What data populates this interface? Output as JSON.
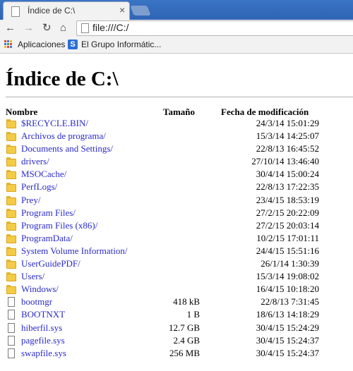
{
  "browser": {
    "tab_title": "Índice de C:\\",
    "tab_close": "×",
    "address": "file:///C:/",
    "bookmarks": [
      {
        "label": "Aplicaciones",
        "icon": "apps-grid-icon"
      },
      {
        "label": "El Grupo Informátic...",
        "icon": "site-favicon-icon"
      }
    ]
  },
  "page": {
    "heading": "Índice de C:\\",
    "columns": {
      "name": "Nombre",
      "size": "Tamaño",
      "date": "Fecha de modificación"
    }
  },
  "entries": [
    {
      "type": "folder",
      "name": "$RECYCLE.BIN/",
      "size": "",
      "date": "24/3/14 15:01:29"
    },
    {
      "type": "folder",
      "name": "Archivos de programa/",
      "size": "",
      "date": "15/3/14 14:25:07"
    },
    {
      "type": "folder",
      "name": "Documents and Settings/",
      "size": "",
      "date": "22/8/13 16:45:52"
    },
    {
      "type": "folder",
      "name": "drivers/",
      "size": "",
      "date": "27/10/14 13:46:40"
    },
    {
      "type": "folder",
      "name": "MSOCache/",
      "size": "",
      "date": "30/4/14 15:00:24"
    },
    {
      "type": "folder",
      "name": "PerfLogs/",
      "size": "",
      "date": "22/8/13 17:22:35"
    },
    {
      "type": "folder",
      "name": "Prey/",
      "size": "",
      "date": "23/4/15 18:53:19"
    },
    {
      "type": "folder",
      "name": "Program Files/",
      "size": "",
      "date": "27/2/15 20:22:09"
    },
    {
      "type": "folder",
      "name": "Program Files (x86)/",
      "size": "",
      "date": "27/2/15 20:03:14"
    },
    {
      "type": "folder",
      "name": "ProgramData/",
      "size": "",
      "date": "10/2/15 17:01:11"
    },
    {
      "type": "folder",
      "name": "System Volume Information/",
      "size": "",
      "date": "24/4/15 15:51:16"
    },
    {
      "type": "folder",
      "name": "UserGuidePDF/",
      "size": "",
      "date": "26/1/14 1:30:39"
    },
    {
      "type": "folder",
      "name": "Users/",
      "size": "",
      "date": "15/3/14 19:08:02"
    },
    {
      "type": "folder",
      "name": "Windows/",
      "size": "",
      "date": "16/4/15 10:18:20"
    },
    {
      "type": "file",
      "name": "bootmgr",
      "size": "418 kB",
      "date": "22/8/13 7:31:45"
    },
    {
      "type": "file",
      "name": "BOOTNXT",
      "size": "1 B",
      "date": "18/6/13 14:18:29"
    },
    {
      "type": "file",
      "name": "hiberfil.sys",
      "size": "12.7 GB",
      "date": "30/4/15 15:24:29"
    },
    {
      "type": "file",
      "name": "pagefile.sys",
      "size": "2.4 GB",
      "date": "30/4/15 15:24:37"
    },
    {
      "type": "file",
      "name": "swapfile.sys",
      "size": "256 MB",
      "date": "30/4/15 15:24:37"
    }
  ]
}
